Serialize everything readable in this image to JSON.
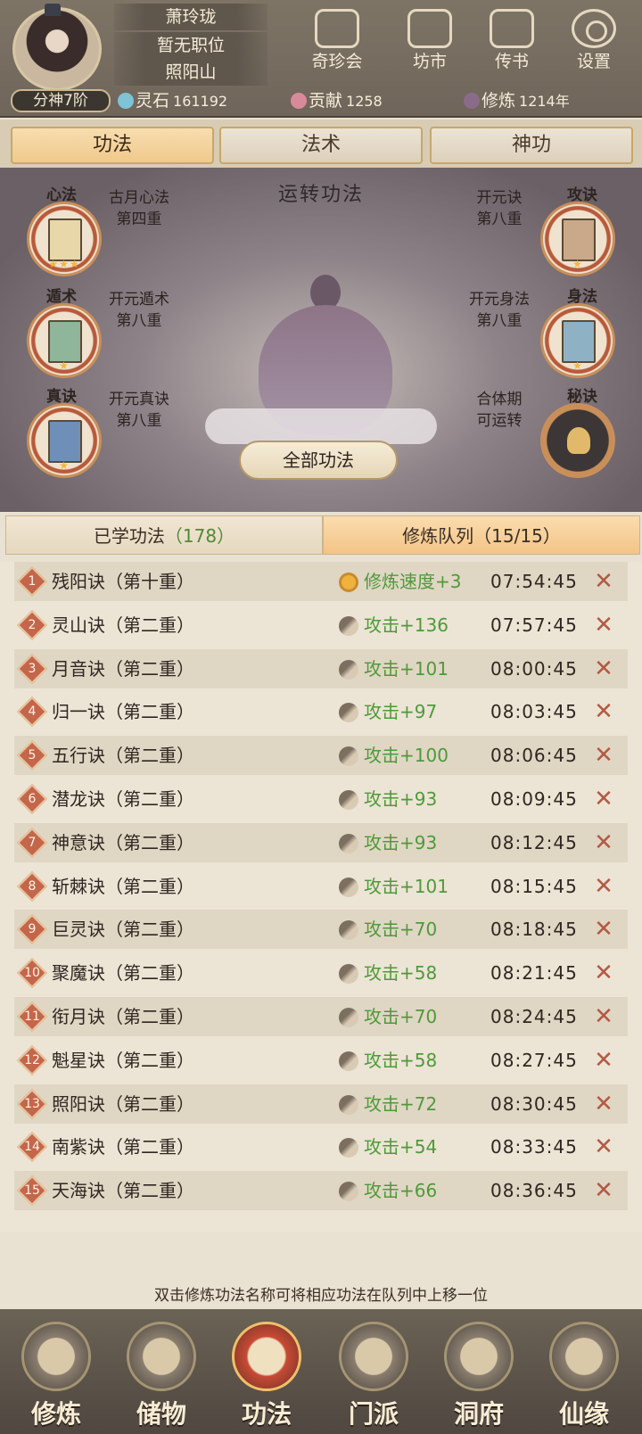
{
  "header": {
    "name": "萧玲珑",
    "position": "暂无职位",
    "location": "照阳山",
    "rank": "分神7阶",
    "buttons": [
      {
        "label": "奇珍会",
        "icon": "treasure-pavilion-icon"
      },
      {
        "label": "坊市",
        "icon": "market-icon"
      },
      {
        "label": "传书",
        "icon": "letter-scroll-icon"
      },
      {
        "label": "设置",
        "icon": "gear-icon"
      }
    ],
    "resources": [
      {
        "label": "灵石",
        "value": "161192",
        "icon": "spirit-stone-icon",
        "color": "#7fc3d6"
      },
      {
        "label": "贡献",
        "value": "1258",
        "icon": "contribution-icon",
        "color": "#d98a9a"
      },
      {
        "label": "修炼",
        "value": "1214年",
        "icon": "cultivation-icon",
        "color": "#8a6b8a"
      }
    ]
  },
  "tabs": [
    {
      "label": "功法",
      "active": true
    },
    {
      "label": "法术",
      "active": false
    },
    {
      "label": "神功",
      "active": false
    }
  ],
  "scene": {
    "title": "运转功法",
    "all_button": "全部功法",
    "slots": [
      {
        "tag": "心法",
        "line1": "古月心法",
        "line2": "第四重",
        "stars": "★★★",
        "book_color": "#e8d7a8"
      },
      {
        "tag": "攻诀",
        "line1": "开元诀",
        "line2": "第八重",
        "stars": "★",
        "book_color": "#c9a98a"
      },
      {
        "tag": "遁术",
        "line1": "开元遁术",
        "line2": "第八重",
        "stars": "★",
        "book_color": "#8fb59a"
      },
      {
        "tag": "身法",
        "line1": "开元身法",
        "line2": "第八重",
        "stars": "★",
        "book_color": "#8fb1c4"
      },
      {
        "tag": "真诀",
        "line1": "开元真诀",
        "line2": "第八重",
        "stars": "★",
        "book_color": "#6f8fb8"
      },
      {
        "tag": "秘诀",
        "line1": "合体期",
        "line2": "可运转",
        "stars": "",
        "book_color": ""
      }
    ]
  },
  "queue_tabs": [
    {
      "label": "已学功法",
      "count": "（178）",
      "active": false
    },
    {
      "label": "修炼队列",
      "count": "（15/15）",
      "active": true
    }
  ],
  "queue": [
    {
      "num": "1",
      "name": "残阳诀（第十重）",
      "stat": "修炼速度+3",
      "time": "07:54:45",
      "icon": "speed"
    },
    {
      "num": "2",
      "name": "灵山诀（第二重）",
      "stat": "攻击+136",
      "time": "07:57:45",
      "icon": "attack"
    },
    {
      "num": "3",
      "name": "月音诀（第二重）",
      "stat": "攻击+101",
      "time": "08:00:45",
      "icon": "attack"
    },
    {
      "num": "4",
      "name": "归一诀（第二重）",
      "stat": "攻击+97",
      "time": "08:03:45",
      "icon": "attack"
    },
    {
      "num": "5",
      "name": "五行诀（第二重）",
      "stat": "攻击+100",
      "time": "08:06:45",
      "icon": "attack"
    },
    {
      "num": "6",
      "name": "潜龙诀（第二重）",
      "stat": "攻击+93",
      "time": "08:09:45",
      "icon": "attack"
    },
    {
      "num": "7",
      "name": "神意诀（第二重）",
      "stat": "攻击+93",
      "time": "08:12:45",
      "icon": "attack"
    },
    {
      "num": "8",
      "name": "斩棘诀（第二重）",
      "stat": "攻击+101",
      "time": "08:15:45",
      "icon": "attack"
    },
    {
      "num": "9",
      "name": "巨灵诀（第二重）",
      "stat": "攻击+70",
      "time": "08:18:45",
      "icon": "attack"
    },
    {
      "num": "10",
      "name": "聚魔诀（第二重）",
      "stat": "攻击+58",
      "time": "08:21:45",
      "icon": "attack"
    },
    {
      "num": "11",
      "name": "衔月诀（第二重）",
      "stat": "攻击+70",
      "time": "08:24:45",
      "icon": "attack"
    },
    {
      "num": "12",
      "name": "魁星诀（第二重）",
      "stat": "攻击+58",
      "time": "08:27:45",
      "icon": "attack"
    },
    {
      "num": "13",
      "name": "照阳诀（第二重）",
      "stat": "攻击+72",
      "time": "08:30:45",
      "icon": "attack"
    },
    {
      "num": "14",
      "name": "南紫诀（第二重）",
      "stat": "攻击+54",
      "time": "08:33:45",
      "icon": "attack"
    },
    {
      "num": "15",
      "name": "天海诀（第二重）",
      "stat": "攻击+66",
      "time": "08:36:45",
      "icon": "attack"
    }
  ],
  "hint": "双击修炼功法名称可将相应功法在队列中上移一位",
  "bottom_nav": [
    {
      "label": "修炼",
      "icon": "cultivate-icon",
      "active": false
    },
    {
      "label": "储物",
      "icon": "storage-bag-icon",
      "active": false
    },
    {
      "label": "功法",
      "icon": "technique-scroll-icon",
      "active": true
    },
    {
      "label": "门派",
      "icon": "sect-gate-icon",
      "active": false
    },
    {
      "label": "洞府",
      "icon": "cave-abode-icon",
      "active": false
    },
    {
      "label": "仙缘",
      "icon": "immortal-fate-icon",
      "active": false
    }
  ]
}
